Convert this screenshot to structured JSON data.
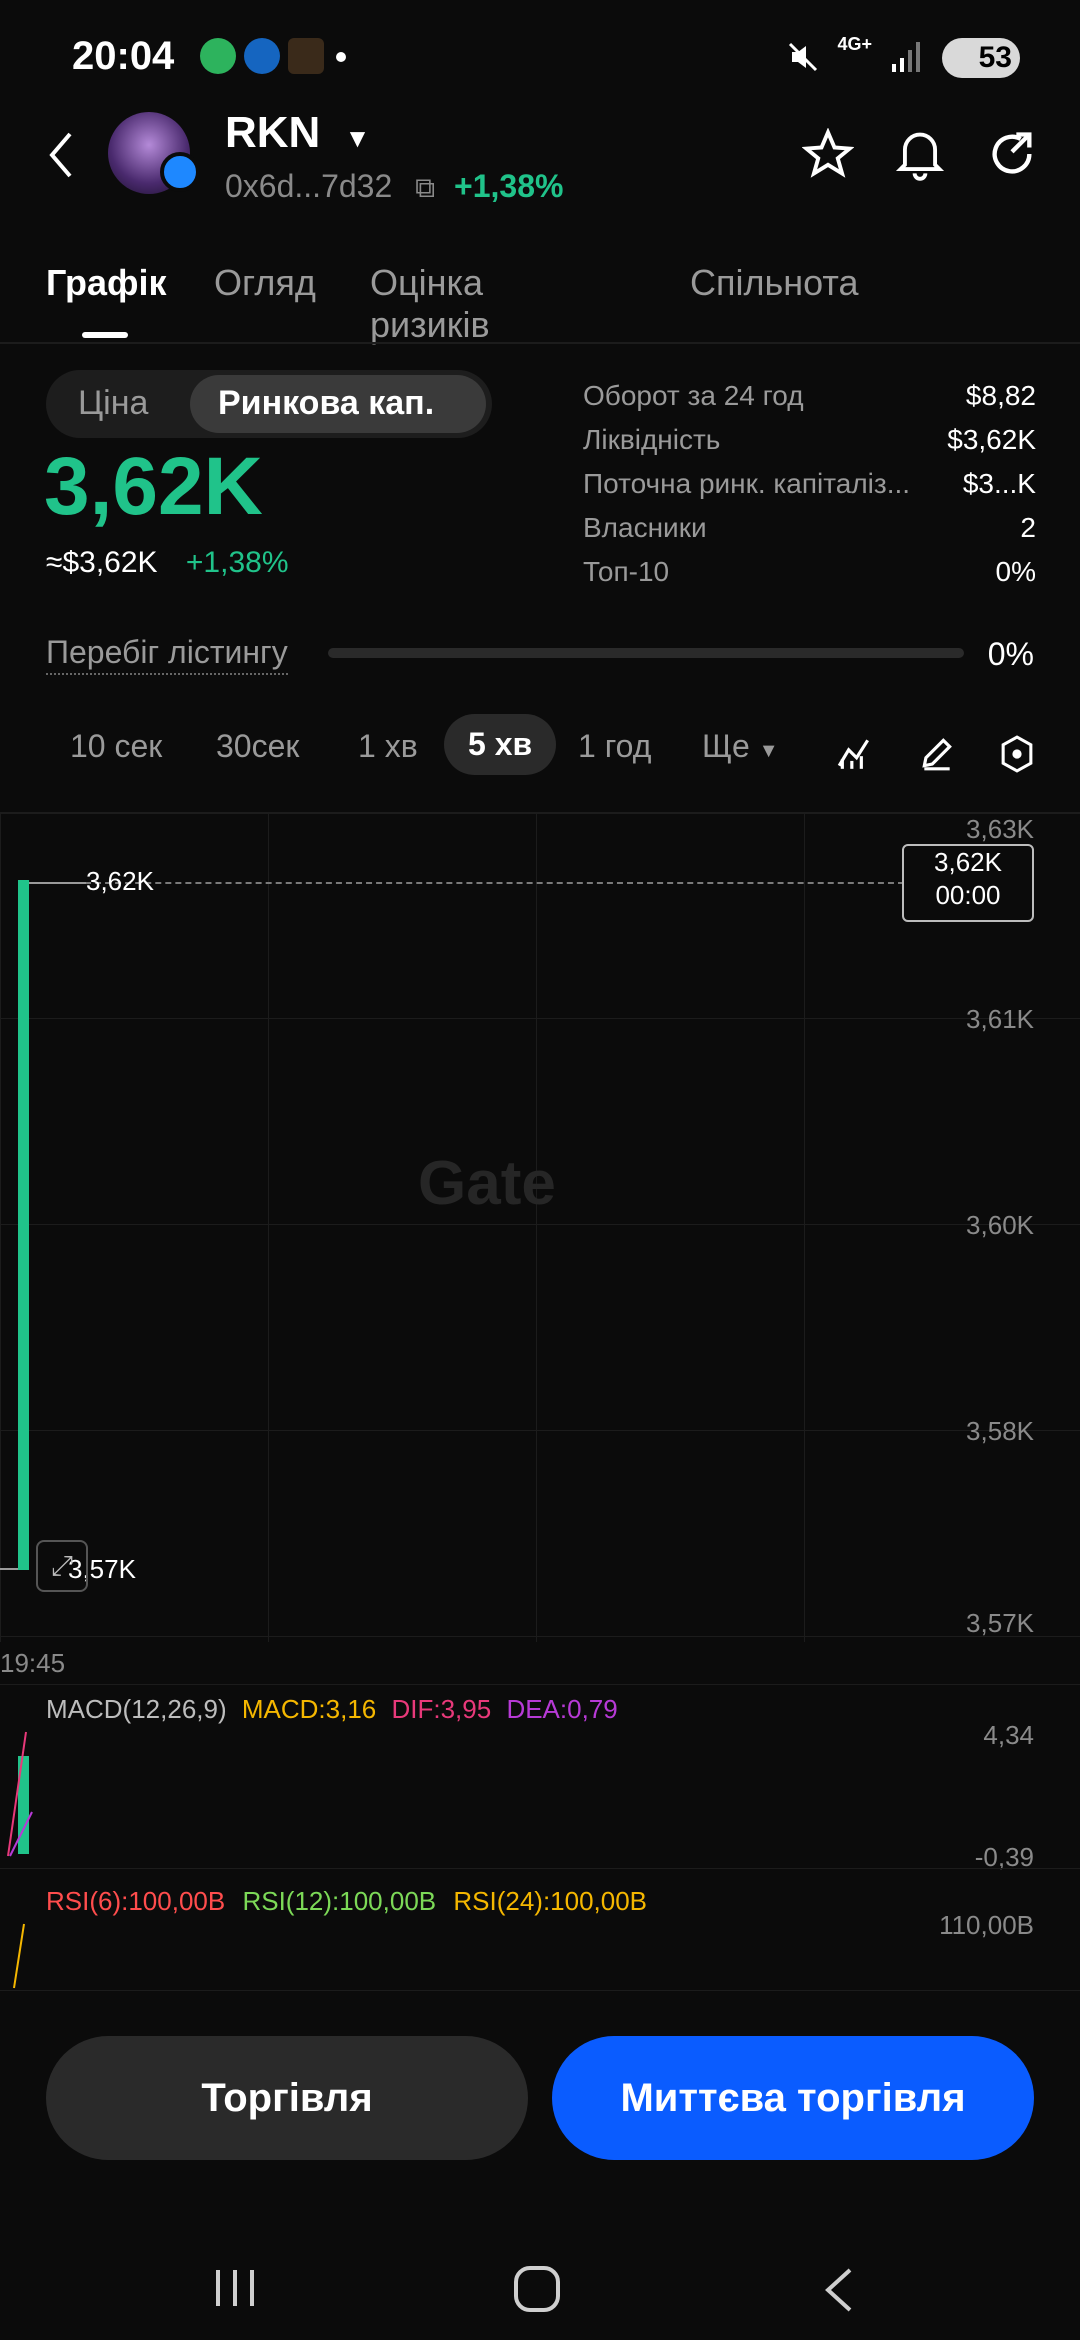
{
  "status_bar": {
    "time": "20:04",
    "network": "4G+",
    "battery": "53"
  },
  "header": {
    "token": "RKN",
    "address": "0x6d...7d32",
    "change": "+1,38%"
  },
  "tabs": [
    "Графік",
    "Огляд",
    "Оцінка ризиків",
    "Спільнота"
  ],
  "price_toggle": {
    "option1": "Ціна",
    "option2": "Ринкова кап."
  },
  "price": {
    "value": "3,62K",
    "usd": "≈$3,62K",
    "change": "+1,38%"
  },
  "stats": [
    {
      "label": "Оборот за 24 год",
      "value": "$8,82"
    },
    {
      "label": "Ліквідність",
      "value": "$3,62K"
    },
    {
      "label": "Поточна ринк. капіталіз...",
      "value": "$3...K"
    },
    {
      "label": "Власники",
      "value": "2"
    },
    {
      "label": "Топ-10",
      "value": "0%"
    }
  ],
  "listing": {
    "label": "Перебіг лістингу",
    "value": "0%",
    "progress": 0
  },
  "intervals": {
    "i1": "10 сек",
    "i2": "30сек",
    "i3": "1 хв",
    "i4": "5 хв",
    "i5": "1 год",
    "more": "Ще"
  },
  "chart": {
    "watermark": "Gate",
    "y_labels": [
      "3,63K",
      "3,61K",
      "3,60K",
      "3,58K",
      "3,57K"
    ],
    "high_label": "3,62K",
    "low_label": "3,57K",
    "current_price": "3,62K",
    "current_time": "00:00",
    "time_label": "19:45"
  },
  "chart_data": {
    "type": "candlestick",
    "x": [
      "19:45"
    ],
    "open": [
      3.57
    ],
    "close": [
      3.62
    ],
    "high": [
      3.62
    ],
    "low": [
      3.57
    ],
    "y_unit": "K",
    "ylim": [
      3.57,
      3.63
    ]
  },
  "macd": {
    "label": "MACD(12,26,9)",
    "macd": "MACD:3,16",
    "dif": "DIF:3,95",
    "dea": "DEA:0,79",
    "top": "4,34",
    "bottom": "-0,39"
  },
  "rsi": {
    "rsi6": "RSI(6):100,00B",
    "rsi12": "RSI(12):100,00B",
    "rsi24": "RSI(24):100,00B",
    "top": "110,00B"
  },
  "buttons": {
    "trade": "Торгівля",
    "instant": "Миттєва торгівля"
  },
  "colors": {
    "green": "#20c38a",
    "blue": "#0a5cff",
    "background": "#0b0b0b"
  }
}
